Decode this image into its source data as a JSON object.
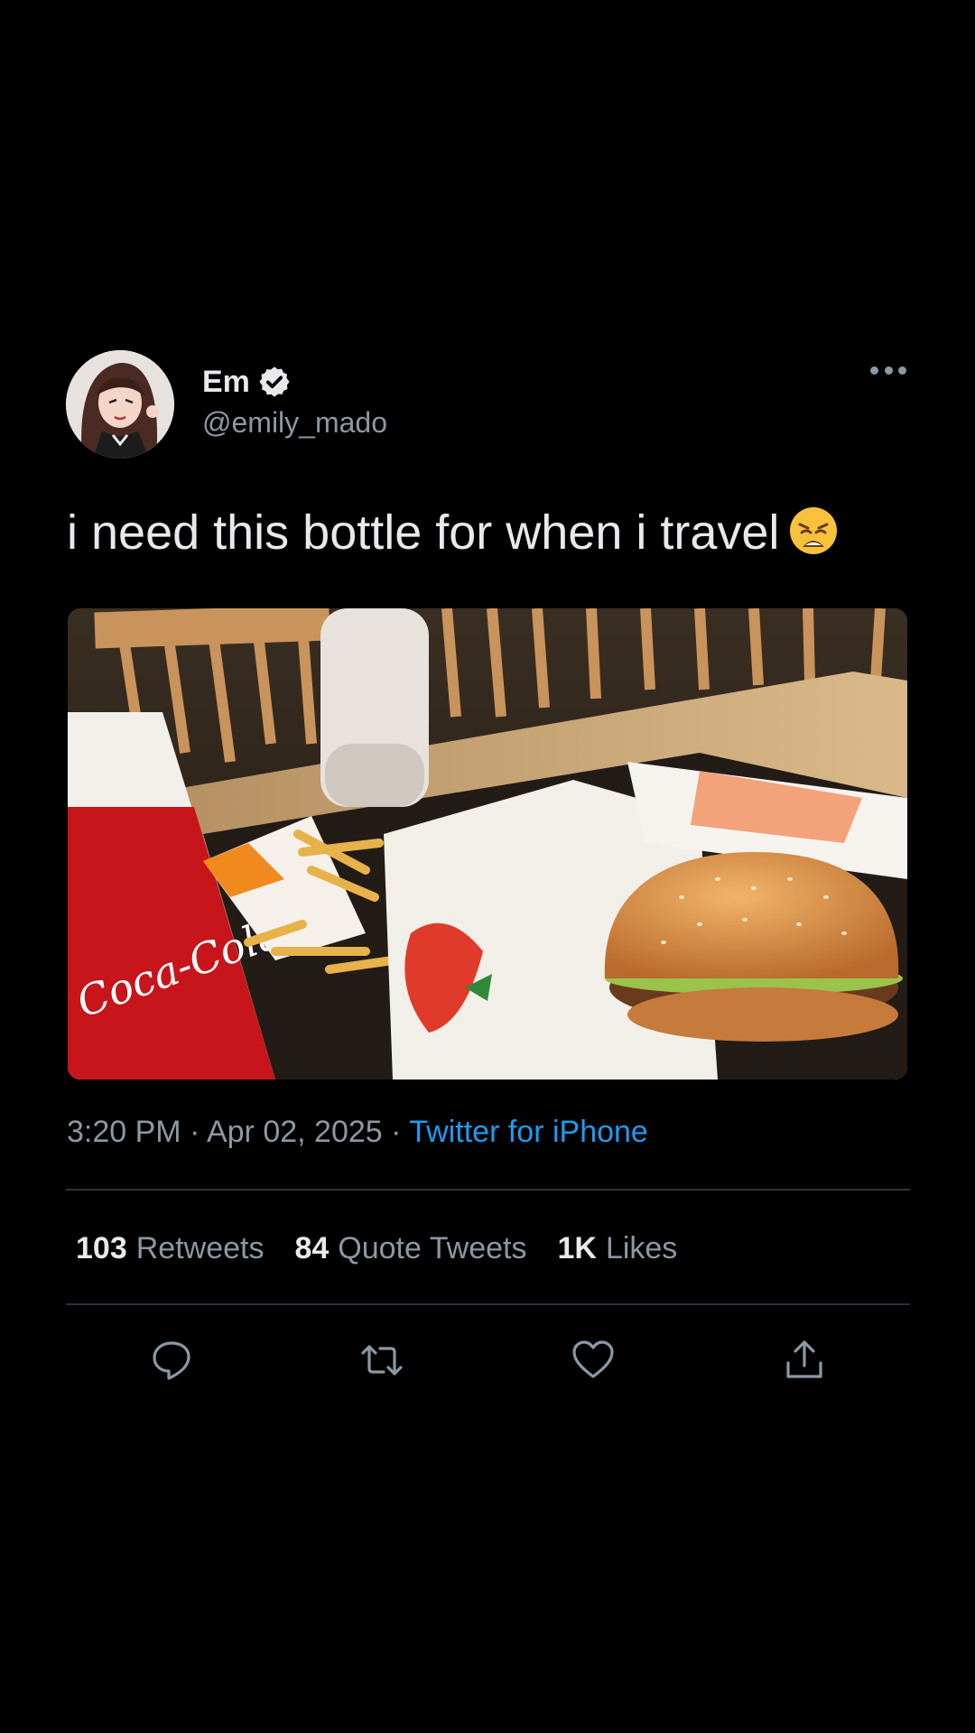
{
  "user": {
    "display_name": "Em",
    "handle": "@emily_mado",
    "verified": true,
    "avatar_icon": "cartoon-avatar"
  },
  "tweet": {
    "text": "i need this bottle for when i travel",
    "emoji": "weary-face",
    "media_description_icon": "photo"
  },
  "meta": {
    "time": "3:20 PM",
    "separator": " · ",
    "date": "Apr 02, 2025",
    "source": "Twitter for iPhone"
  },
  "stats": [
    {
      "count": "103",
      "label": "Retweets"
    },
    {
      "count": "84",
      "label": "Quote Tweets"
    },
    {
      "count": "1K",
      "label": "Likes"
    }
  ],
  "actions": [
    "reply-icon",
    "retweet-icon",
    "like-icon",
    "share-icon"
  ],
  "colors": {
    "background": "#000000",
    "text_primary": "#e7e9ea",
    "text_secondary": "#8b98a5",
    "accent": "#1d9bf0",
    "divider": "#2f3336"
  }
}
